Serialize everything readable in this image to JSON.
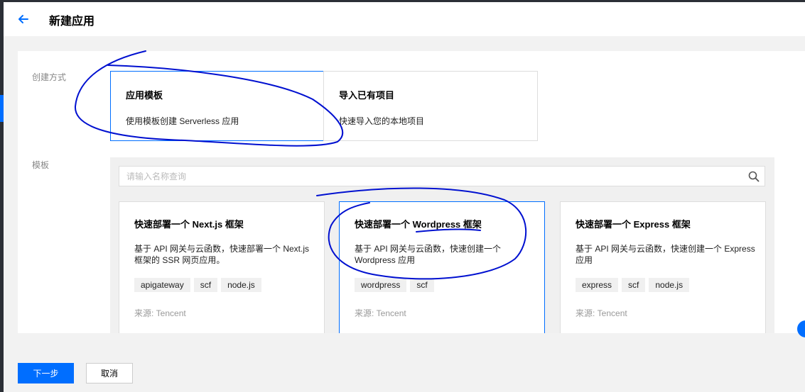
{
  "header": {
    "title": "新建应用"
  },
  "form": {
    "method_label": "创建方式",
    "template_label": "模板",
    "methods": [
      {
        "title": "应用模板",
        "desc": "使用模板创建 Serverless 应用",
        "selected": true
      },
      {
        "title": "导入已有项目",
        "desc": "快速导入您的本地项目",
        "selected": false
      }
    ]
  },
  "search": {
    "placeholder": "请输入名称查询",
    "value": ""
  },
  "templates": [
    {
      "title": "快速部署一个 Next.js 框架",
      "desc": "基于 API 网关与云函数，快速部署一个 Next.js 框架的 SSR 网页应用。",
      "tags": [
        "apigateway",
        "scf",
        "node.js"
      ],
      "source": "来源: Tencent",
      "selected": false
    },
    {
      "title": "快速部署一个 Wordpress 框架",
      "desc": "基于 API 网关与云函数，快速创建一个 Wordpress 应用",
      "tags": [
        "wordpress",
        "scf"
      ],
      "source": "来源: Tencent",
      "selected": true
    },
    {
      "title": "快速部署一个 Express 框架",
      "desc": "基于 API 网关与云函数，快速创建一个 Express 应用",
      "tags": [
        "express",
        "scf",
        "node.js"
      ],
      "source": "来源: Tencent",
      "selected": false
    }
  ],
  "footer": {
    "next_label": "下一步",
    "cancel_label": "取消"
  },
  "colors": {
    "accent": "#006eff",
    "annotation": "#0010d0"
  },
  "icons": {
    "back": "arrow-left-icon",
    "search": "search-icon"
  }
}
